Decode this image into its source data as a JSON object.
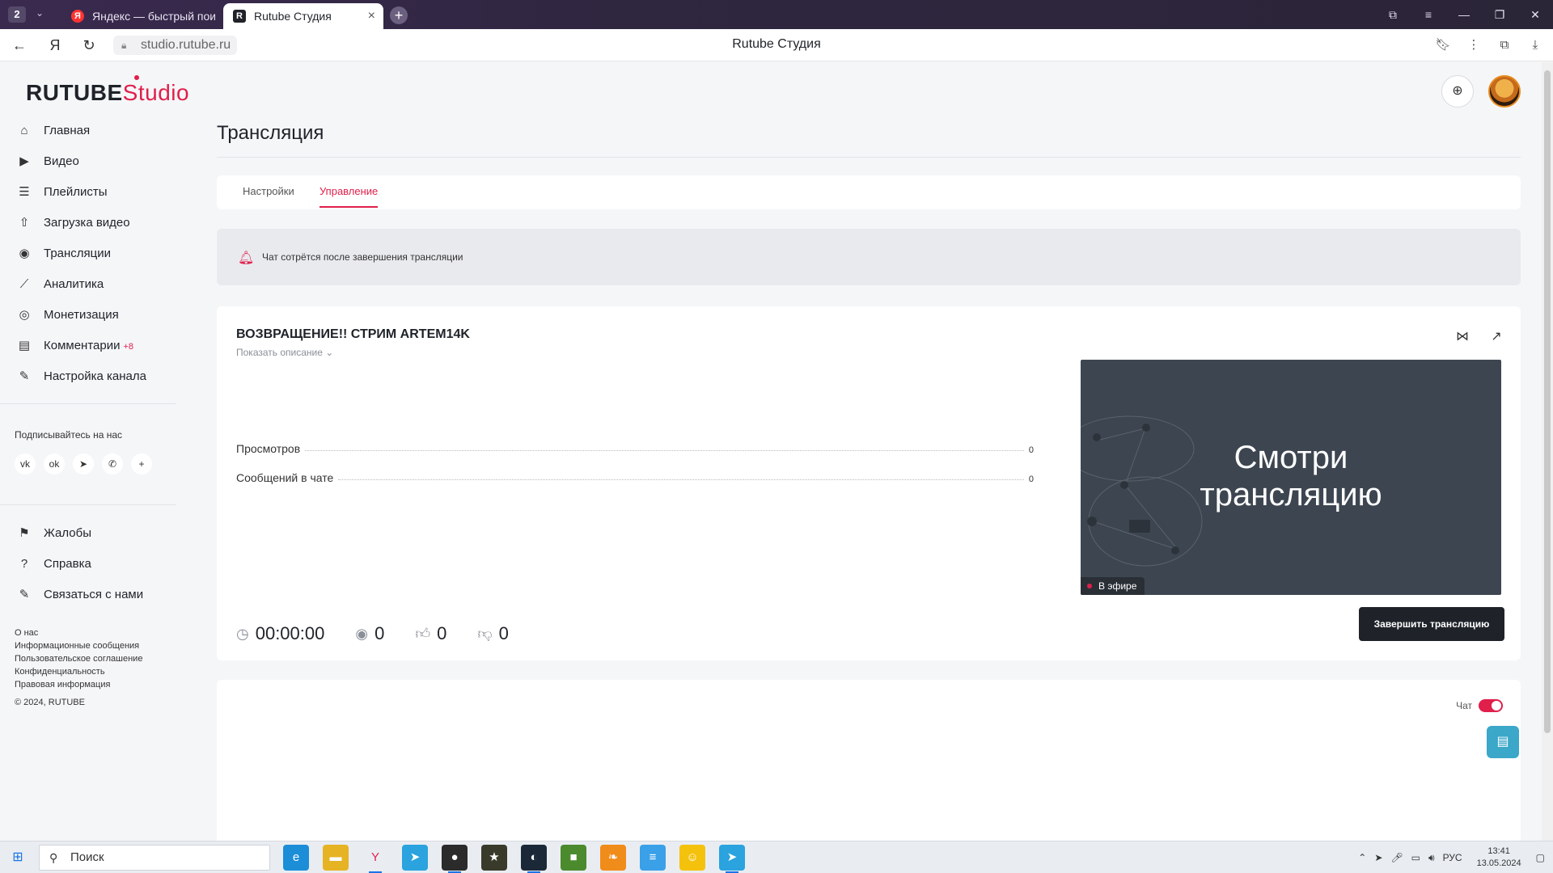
{
  "browser": {
    "tab_count": "2",
    "tabs": [
      {
        "label": "Яндекс — быстрый поиск",
        "favicon": "Я"
      },
      {
        "label": "Rutube Студия",
        "favicon": "R"
      }
    ],
    "url": "studio.rutube.ru",
    "page_title": "Rutube Студия"
  },
  "brand": {
    "name": "RUTUBE",
    "suffix": "Studio",
    "accent_color": "#e01f4b"
  },
  "sidebar": {
    "items": [
      {
        "label": "Главная",
        "icon": "home-icon",
        "glyph": "⌂"
      },
      {
        "label": "Видео",
        "icon": "video-icon",
        "glyph": "▶"
      },
      {
        "label": "Плейлисты",
        "icon": "playlist-icon",
        "glyph": "☰"
      },
      {
        "label": "Загрузка видео",
        "icon": "upload-icon",
        "glyph": "⇧"
      },
      {
        "label": "Трансляции",
        "icon": "broadcast-icon",
        "glyph": "◉"
      },
      {
        "label": "Аналитика",
        "icon": "analytics-icon",
        "glyph": "⟋"
      },
      {
        "label": "Монетизация",
        "icon": "monetization-icon",
        "glyph": "◎"
      },
      {
        "label": "Комментарии",
        "icon": "comments-icon",
        "glyph": "▤",
        "badge": "+8"
      },
      {
        "label": "Настройка канала",
        "icon": "channel-settings-icon",
        "glyph": "✎"
      }
    ],
    "social_title": "Подписывайтесь на нас",
    "social": [
      {
        "icon": "vk-icon",
        "glyph": "vk"
      },
      {
        "icon": "ok-icon",
        "glyph": "ok"
      },
      {
        "icon": "telegram-icon",
        "glyph": "➤"
      },
      {
        "icon": "viber-icon",
        "glyph": "✆"
      },
      {
        "icon": "more-icon",
        "glyph": "+"
      }
    ],
    "help_items": [
      {
        "label": "Жалобы",
        "icon": "flag-icon",
        "glyph": "⚑"
      },
      {
        "label": "Справка",
        "icon": "help-icon",
        "glyph": "?"
      },
      {
        "label": "Связаться с нами",
        "icon": "contact-icon",
        "glyph": "✎"
      }
    ],
    "footer_links": [
      "О нас",
      "Информационные сообщения",
      "Пользовательское соглашение",
      "Конфиденциальность",
      "Правовая информация"
    ],
    "copyright": "© 2024, RUTUBE"
  },
  "main": {
    "title": "Трансляция",
    "tabs": [
      {
        "label": "Настройки",
        "active": false
      },
      {
        "label": "Управление",
        "active": true
      }
    ],
    "notice": "Чат сотрётся после завершения трансляции",
    "stream": {
      "title": "ВОЗВРАЩЕНИЕ!! СТРИМ ARTEM14K",
      "show_description": "Показать описание",
      "stats": [
        {
          "label": "Просмотров",
          "value": "0"
        },
        {
          "label": "Сообщений в чате",
          "value": "0"
        }
      ],
      "preview_text_line1": "Смотри",
      "preview_text_line2": "трансляцию",
      "live_badge": "В эфире",
      "metrics": {
        "duration": "00:00:00",
        "viewers": "0",
        "likes": "0",
        "dislikes": "0"
      },
      "end_button": "Завершить трансляцию"
    },
    "chat": {
      "label": "Чат",
      "enabled": true
    }
  },
  "taskbar": {
    "search_placeholder": "Поиск",
    "apps": [
      {
        "icon": "edge-icon",
        "color": "#1c8ed8",
        "glyph": "e"
      },
      {
        "icon": "explorer-icon",
        "color": "#e6b324",
        "glyph": "▬"
      },
      {
        "icon": "yandex-browser-icon",
        "color": "#e9edf2",
        "glyph": "Y",
        "running": true
      },
      {
        "icon": "telegram-icon",
        "color": "#2aa3df",
        "glyph": "➤"
      },
      {
        "icon": "obs-icon",
        "color": "#2b2b2b",
        "glyph": "●",
        "running": true
      },
      {
        "icon": "game-icon",
        "color": "#3a3a2a",
        "glyph": "★"
      },
      {
        "icon": "steam-icon",
        "color": "#1b2838",
        "glyph": "◐",
        "running": true
      },
      {
        "icon": "minecraft-icon",
        "color": "#4b8a2d",
        "glyph": "■"
      },
      {
        "icon": "fl-studio-icon",
        "color": "#f08c1a",
        "glyph": "❧"
      },
      {
        "icon": "stack-app-icon",
        "color": "#3aa0e8",
        "glyph": "≡"
      },
      {
        "icon": "app-icon",
        "color": "#f4c20d",
        "glyph": "☺"
      },
      {
        "icon": "telegram-desktop-icon",
        "color": "#2aa3df",
        "glyph": "➤",
        "running": true
      }
    ],
    "language": "РУС",
    "time": "13:41",
    "date": "13.05.2024"
  }
}
